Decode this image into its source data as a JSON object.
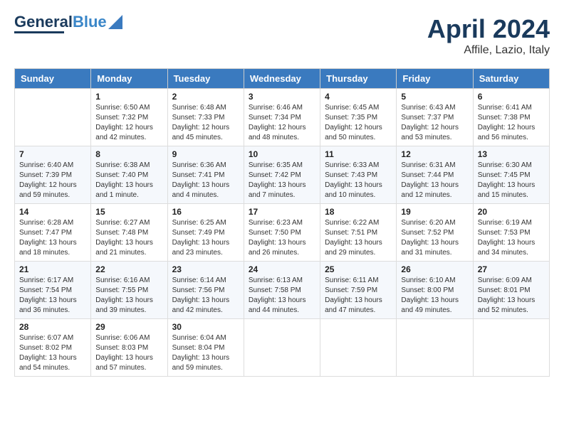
{
  "header": {
    "logo_line1": "General",
    "logo_line2": "Blue",
    "month": "April 2024",
    "location": "Affile, Lazio, Italy"
  },
  "days_of_week": [
    "Sunday",
    "Monday",
    "Tuesday",
    "Wednesday",
    "Thursday",
    "Friday",
    "Saturday"
  ],
  "weeks": [
    [
      {
        "day": "",
        "sunrise": "",
        "sunset": "",
        "daylight": ""
      },
      {
        "day": "1",
        "sunrise": "Sunrise: 6:50 AM",
        "sunset": "Sunset: 7:32 PM",
        "daylight": "Daylight: 12 hours and 42 minutes."
      },
      {
        "day": "2",
        "sunrise": "Sunrise: 6:48 AM",
        "sunset": "Sunset: 7:33 PM",
        "daylight": "Daylight: 12 hours and 45 minutes."
      },
      {
        "day": "3",
        "sunrise": "Sunrise: 6:46 AM",
        "sunset": "Sunset: 7:34 PM",
        "daylight": "Daylight: 12 hours and 48 minutes."
      },
      {
        "day": "4",
        "sunrise": "Sunrise: 6:45 AM",
        "sunset": "Sunset: 7:35 PM",
        "daylight": "Daylight: 12 hours and 50 minutes."
      },
      {
        "day": "5",
        "sunrise": "Sunrise: 6:43 AM",
        "sunset": "Sunset: 7:37 PM",
        "daylight": "Daylight: 12 hours and 53 minutes."
      },
      {
        "day": "6",
        "sunrise": "Sunrise: 6:41 AM",
        "sunset": "Sunset: 7:38 PM",
        "daylight": "Daylight: 12 hours and 56 minutes."
      }
    ],
    [
      {
        "day": "7",
        "sunrise": "Sunrise: 6:40 AM",
        "sunset": "Sunset: 7:39 PM",
        "daylight": "Daylight: 12 hours and 59 minutes."
      },
      {
        "day": "8",
        "sunrise": "Sunrise: 6:38 AM",
        "sunset": "Sunset: 7:40 PM",
        "daylight": "Daylight: 13 hours and 1 minute."
      },
      {
        "day": "9",
        "sunrise": "Sunrise: 6:36 AM",
        "sunset": "Sunset: 7:41 PM",
        "daylight": "Daylight: 13 hours and 4 minutes."
      },
      {
        "day": "10",
        "sunrise": "Sunrise: 6:35 AM",
        "sunset": "Sunset: 7:42 PM",
        "daylight": "Daylight: 13 hours and 7 minutes."
      },
      {
        "day": "11",
        "sunrise": "Sunrise: 6:33 AM",
        "sunset": "Sunset: 7:43 PM",
        "daylight": "Daylight: 13 hours and 10 minutes."
      },
      {
        "day": "12",
        "sunrise": "Sunrise: 6:31 AM",
        "sunset": "Sunset: 7:44 PM",
        "daylight": "Daylight: 13 hours and 12 minutes."
      },
      {
        "day": "13",
        "sunrise": "Sunrise: 6:30 AM",
        "sunset": "Sunset: 7:45 PM",
        "daylight": "Daylight: 13 hours and 15 minutes."
      }
    ],
    [
      {
        "day": "14",
        "sunrise": "Sunrise: 6:28 AM",
        "sunset": "Sunset: 7:47 PM",
        "daylight": "Daylight: 13 hours and 18 minutes."
      },
      {
        "day": "15",
        "sunrise": "Sunrise: 6:27 AM",
        "sunset": "Sunset: 7:48 PM",
        "daylight": "Daylight: 13 hours and 21 minutes."
      },
      {
        "day": "16",
        "sunrise": "Sunrise: 6:25 AM",
        "sunset": "Sunset: 7:49 PM",
        "daylight": "Daylight: 13 hours and 23 minutes."
      },
      {
        "day": "17",
        "sunrise": "Sunrise: 6:23 AM",
        "sunset": "Sunset: 7:50 PM",
        "daylight": "Daylight: 13 hours and 26 minutes."
      },
      {
        "day": "18",
        "sunrise": "Sunrise: 6:22 AM",
        "sunset": "Sunset: 7:51 PM",
        "daylight": "Daylight: 13 hours and 29 minutes."
      },
      {
        "day": "19",
        "sunrise": "Sunrise: 6:20 AM",
        "sunset": "Sunset: 7:52 PM",
        "daylight": "Daylight: 13 hours and 31 minutes."
      },
      {
        "day": "20",
        "sunrise": "Sunrise: 6:19 AM",
        "sunset": "Sunset: 7:53 PM",
        "daylight": "Daylight: 13 hours and 34 minutes."
      }
    ],
    [
      {
        "day": "21",
        "sunrise": "Sunrise: 6:17 AM",
        "sunset": "Sunset: 7:54 PM",
        "daylight": "Daylight: 13 hours and 36 minutes."
      },
      {
        "day": "22",
        "sunrise": "Sunrise: 6:16 AM",
        "sunset": "Sunset: 7:55 PM",
        "daylight": "Daylight: 13 hours and 39 minutes."
      },
      {
        "day": "23",
        "sunrise": "Sunrise: 6:14 AM",
        "sunset": "Sunset: 7:56 PM",
        "daylight": "Daylight: 13 hours and 42 minutes."
      },
      {
        "day": "24",
        "sunrise": "Sunrise: 6:13 AM",
        "sunset": "Sunset: 7:58 PM",
        "daylight": "Daylight: 13 hours and 44 minutes."
      },
      {
        "day": "25",
        "sunrise": "Sunrise: 6:11 AM",
        "sunset": "Sunset: 7:59 PM",
        "daylight": "Daylight: 13 hours and 47 minutes."
      },
      {
        "day": "26",
        "sunrise": "Sunrise: 6:10 AM",
        "sunset": "Sunset: 8:00 PM",
        "daylight": "Daylight: 13 hours and 49 minutes."
      },
      {
        "day": "27",
        "sunrise": "Sunrise: 6:09 AM",
        "sunset": "Sunset: 8:01 PM",
        "daylight": "Daylight: 13 hours and 52 minutes."
      }
    ],
    [
      {
        "day": "28",
        "sunrise": "Sunrise: 6:07 AM",
        "sunset": "Sunset: 8:02 PM",
        "daylight": "Daylight: 13 hours and 54 minutes."
      },
      {
        "day": "29",
        "sunrise": "Sunrise: 6:06 AM",
        "sunset": "Sunset: 8:03 PM",
        "daylight": "Daylight: 13 hours and 57 minutes."
      },
      {
        "day": "30",
        "sunrise": "Sunrise: 6:04 AM",
        "sunset": "Sunset: 8:04 PM",
        "daylight": "Daylight: 13 hours and 59 minutes."
      },
      {
        "day": "",
        "sunrise": "",
        "sunset": "",
        "daylight": ""
      },
      {
        "day": "",
        "sunrise": "",
        "sunset": "",
        "daylight": ""
      },
      {
        "day": "",
        "sunrise": "",
        "sunset": "",
        "daylight": ""
      },
      {
        "day": "",
        "sunrise": "",
        "sunset": "",
        "daylight": ""
      }
    ]
  ]
}
